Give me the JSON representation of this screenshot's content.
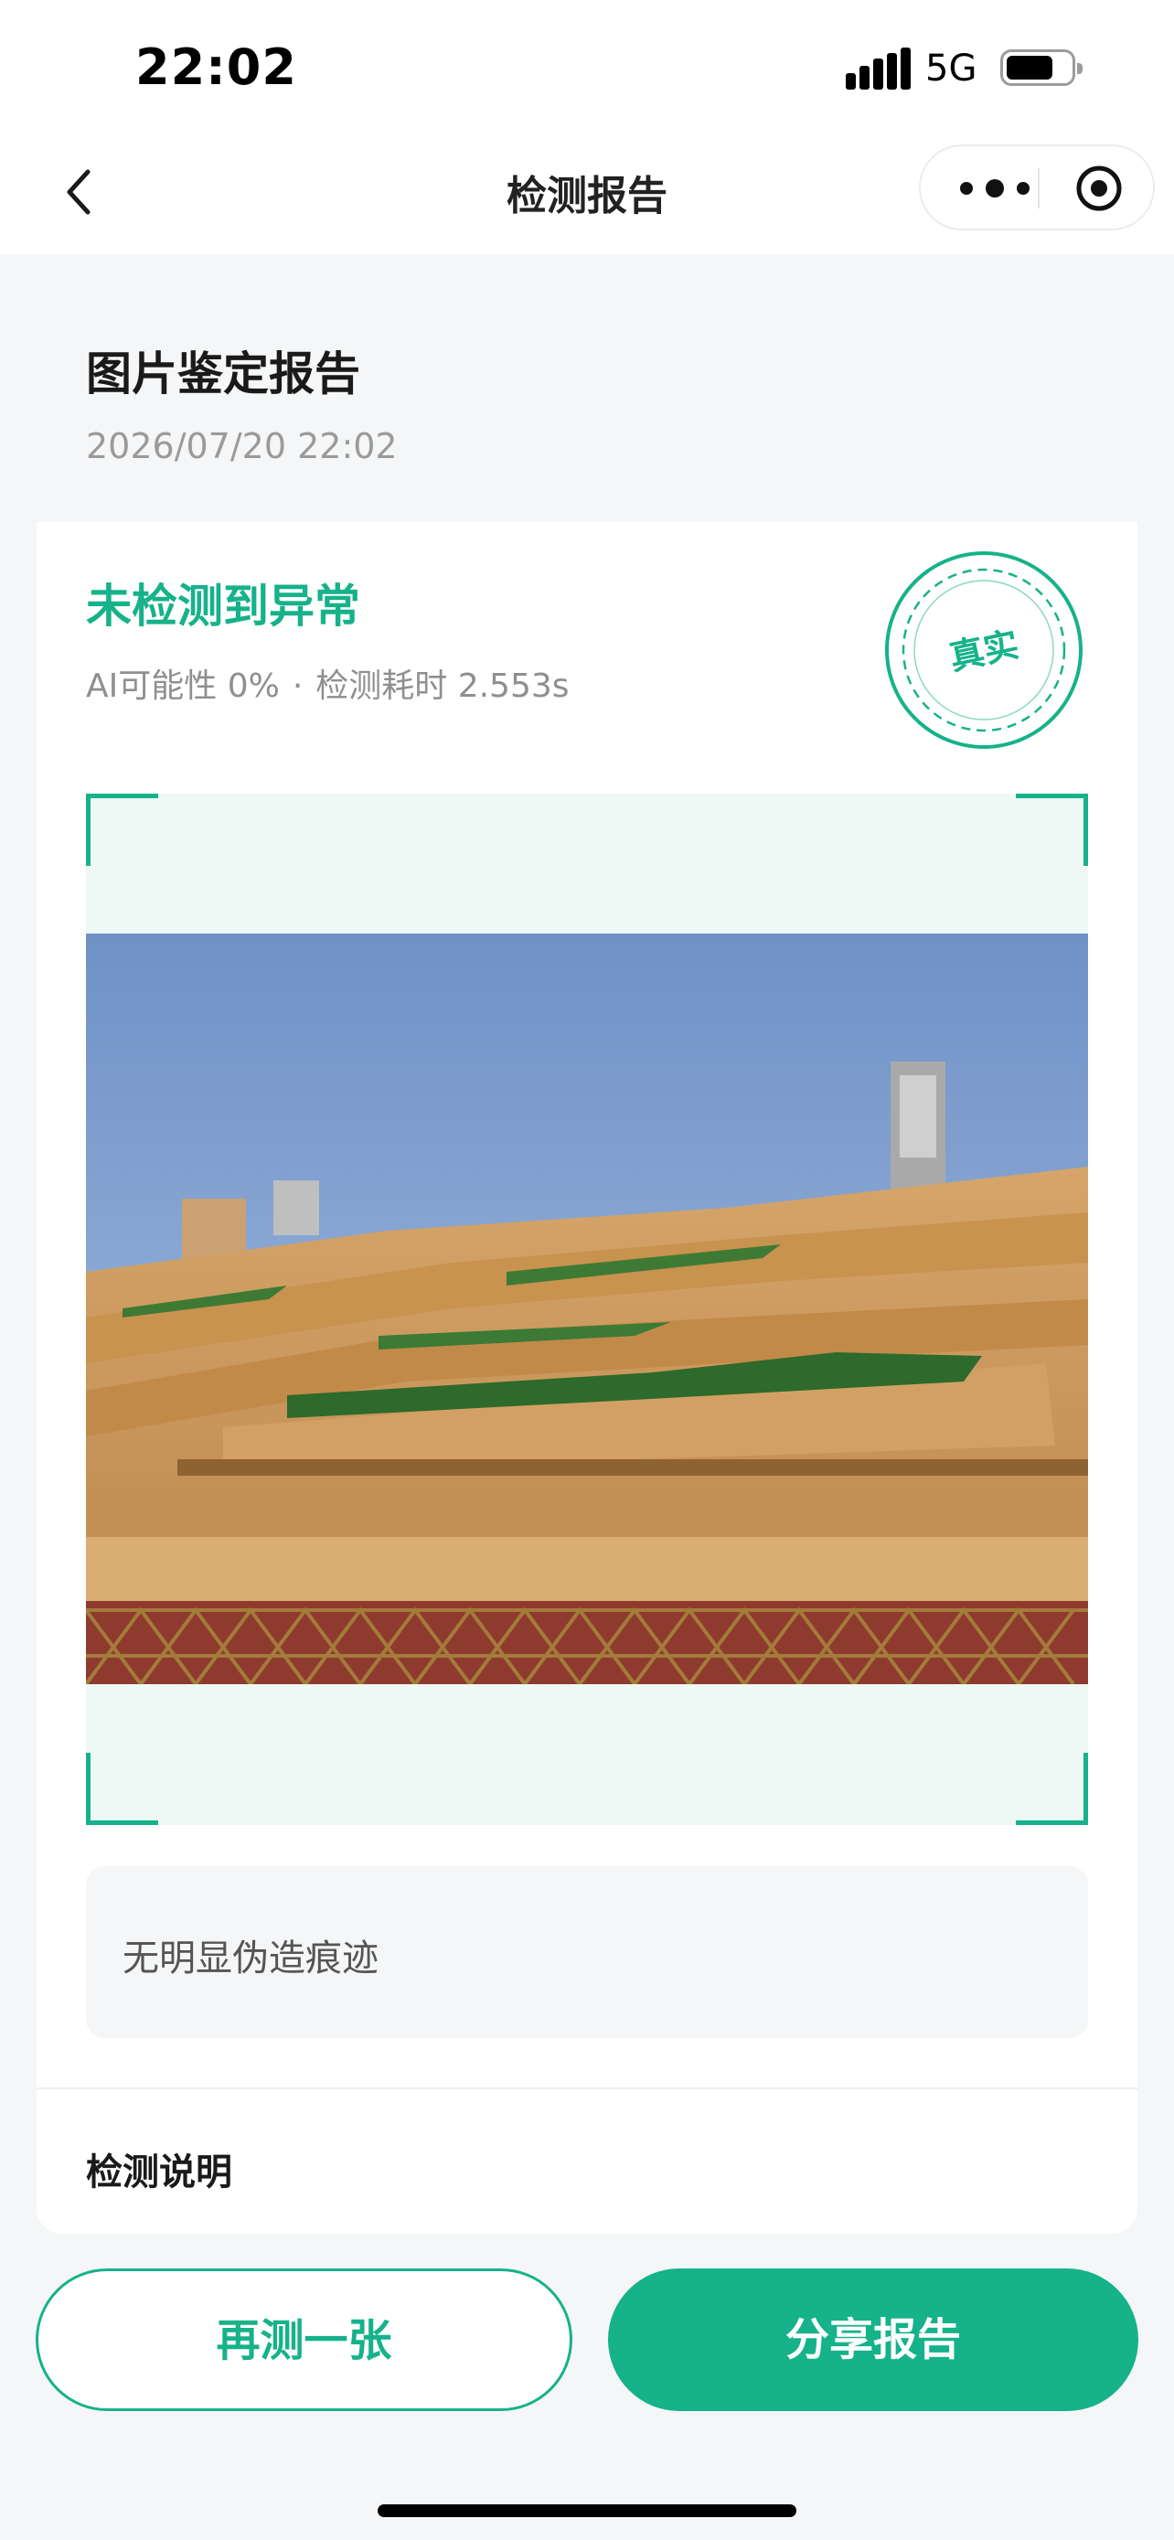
{
  "status_bar": {
    "time": "22:02",
    "network": "5G"
  },
  "nav": {
    "title": "检测报告"
  },
  "report": {
    "title": "图片鉴定报告",
    "datetime": "2026/07/20 22:02"
  },
  "result": {
    "title": "未检测到异常",
    "ai_probability": "AI可能性 0%",
    "separator": "·",
    "duration": "检测耗时 2.553s",
    "stamp_label": "真实"
  },
  "verdict": {
    "text": "无明显伪造痕迹"
  },
  "section": {
    "title": "检测说明"
  },
  "actions": {
    "retry_label": "再测一张",
    "share_label": "分享报告"
  },
  "colors": {
    "accent": "#16b28a",
    "frame_bg": "#eef8f4",
    "page_bg": "#f5f6f7"
  },
  "icons": {
    "back": "chevron-left-icon",
    "more": "more-dots-icon",
    "close": "target-circle-icon",
    "stamp": "seal-stamp-icon"
  }
}
